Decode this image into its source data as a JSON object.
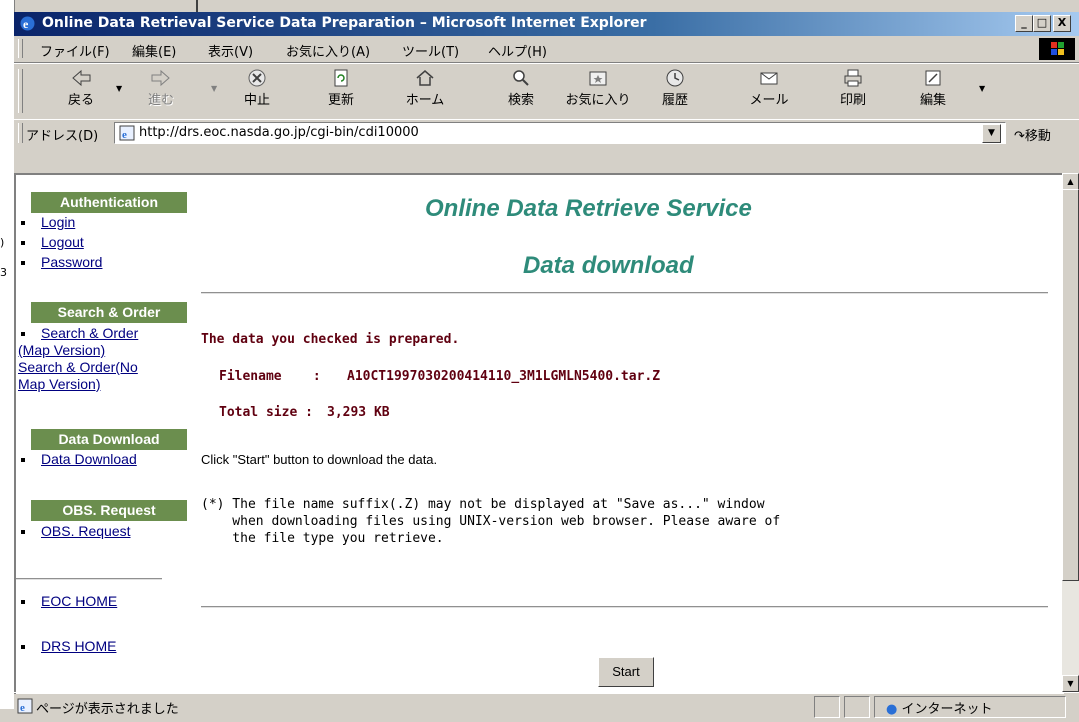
{
  "desktop": {
    "marks": [
      ")",
      "3"
    ]
  },
  "window": {
    "title": "Online Data Retrieval Service Data Preparation – Microsoft Internet Explorer",
    "buttons": {
      "minimize": "_",
      "maximize": "□",
      "close": "X"
    }
  },
  "menubar": {
    "items": [
      "ファイル(F)",
      "編集(E)",
      "表示(V)",
      "お気に入り(A)",
      "ツール(T)",
      "ヘルプ(H)"
    ]
  },
  "toolbar": {
    "back": "戻る",
    "forward": "進む",
    "stop": "中止",
    "refresh": "更新",
    "home": "ホーム",
    "search": "検索",
    "favorites": "お気に入り",
    "history": "履歴",
    "mail": "メール",
    "print": "印刷",
    "edit": "編集"
  },
  "addressbar": {
    "label": "アドレス(D)",
    "url": "http://drs.eoc.nasda.go.jp/cgi-bin/cdi10000",
    "go": "移動"
  },
  "sidebar": {
    "auth_head": "Authentication",
    "login": "Login",
    "logout": "Logout",
    "password": "Password",
    "search_head": "Search & Order",
    "search_map_1": "Search & Order",
    "search_map_2": "(Map Version)",
    "search_nomap_1": "Search & Order(No",
    "search_nomap_2": "Map Version)",
    "download_head": "Data Download",
    "download": "Data Download",
    "obs_head": "OBS. Request",
    "obs": "OBS. Request",
    "eoc_home": "EOC HOME",
    "drs_home": "DRS HOME"
  },
  "main": {
    "title": "Online Data Retrieve Service",
    "subtitle": "Data download",
    "prepared": "The data you checked is prepared.",
    "filename_label": "Filename    :",
    "filename": "A10CT1997030200414110_3M1LGMLN5400.tar.Z",
    "total_label": "Total size :",
    "total_size": "3,293 KB",
    "instruction": "Click \"Start\" button to download the data.",
    "note_1": "(*) The file name suffix(.Z) may not be displayed at \"Save as...\" window",
    "note_2": "    when downloading files using UNIX-version web browser. Please aware of",
    "note_3": "    the file type you retrieve.",
    "start_button": "Start"
  },
  "statusbar": {
    "text": "ページが表示されました",
    "zone": "インターネット"
  }
}
